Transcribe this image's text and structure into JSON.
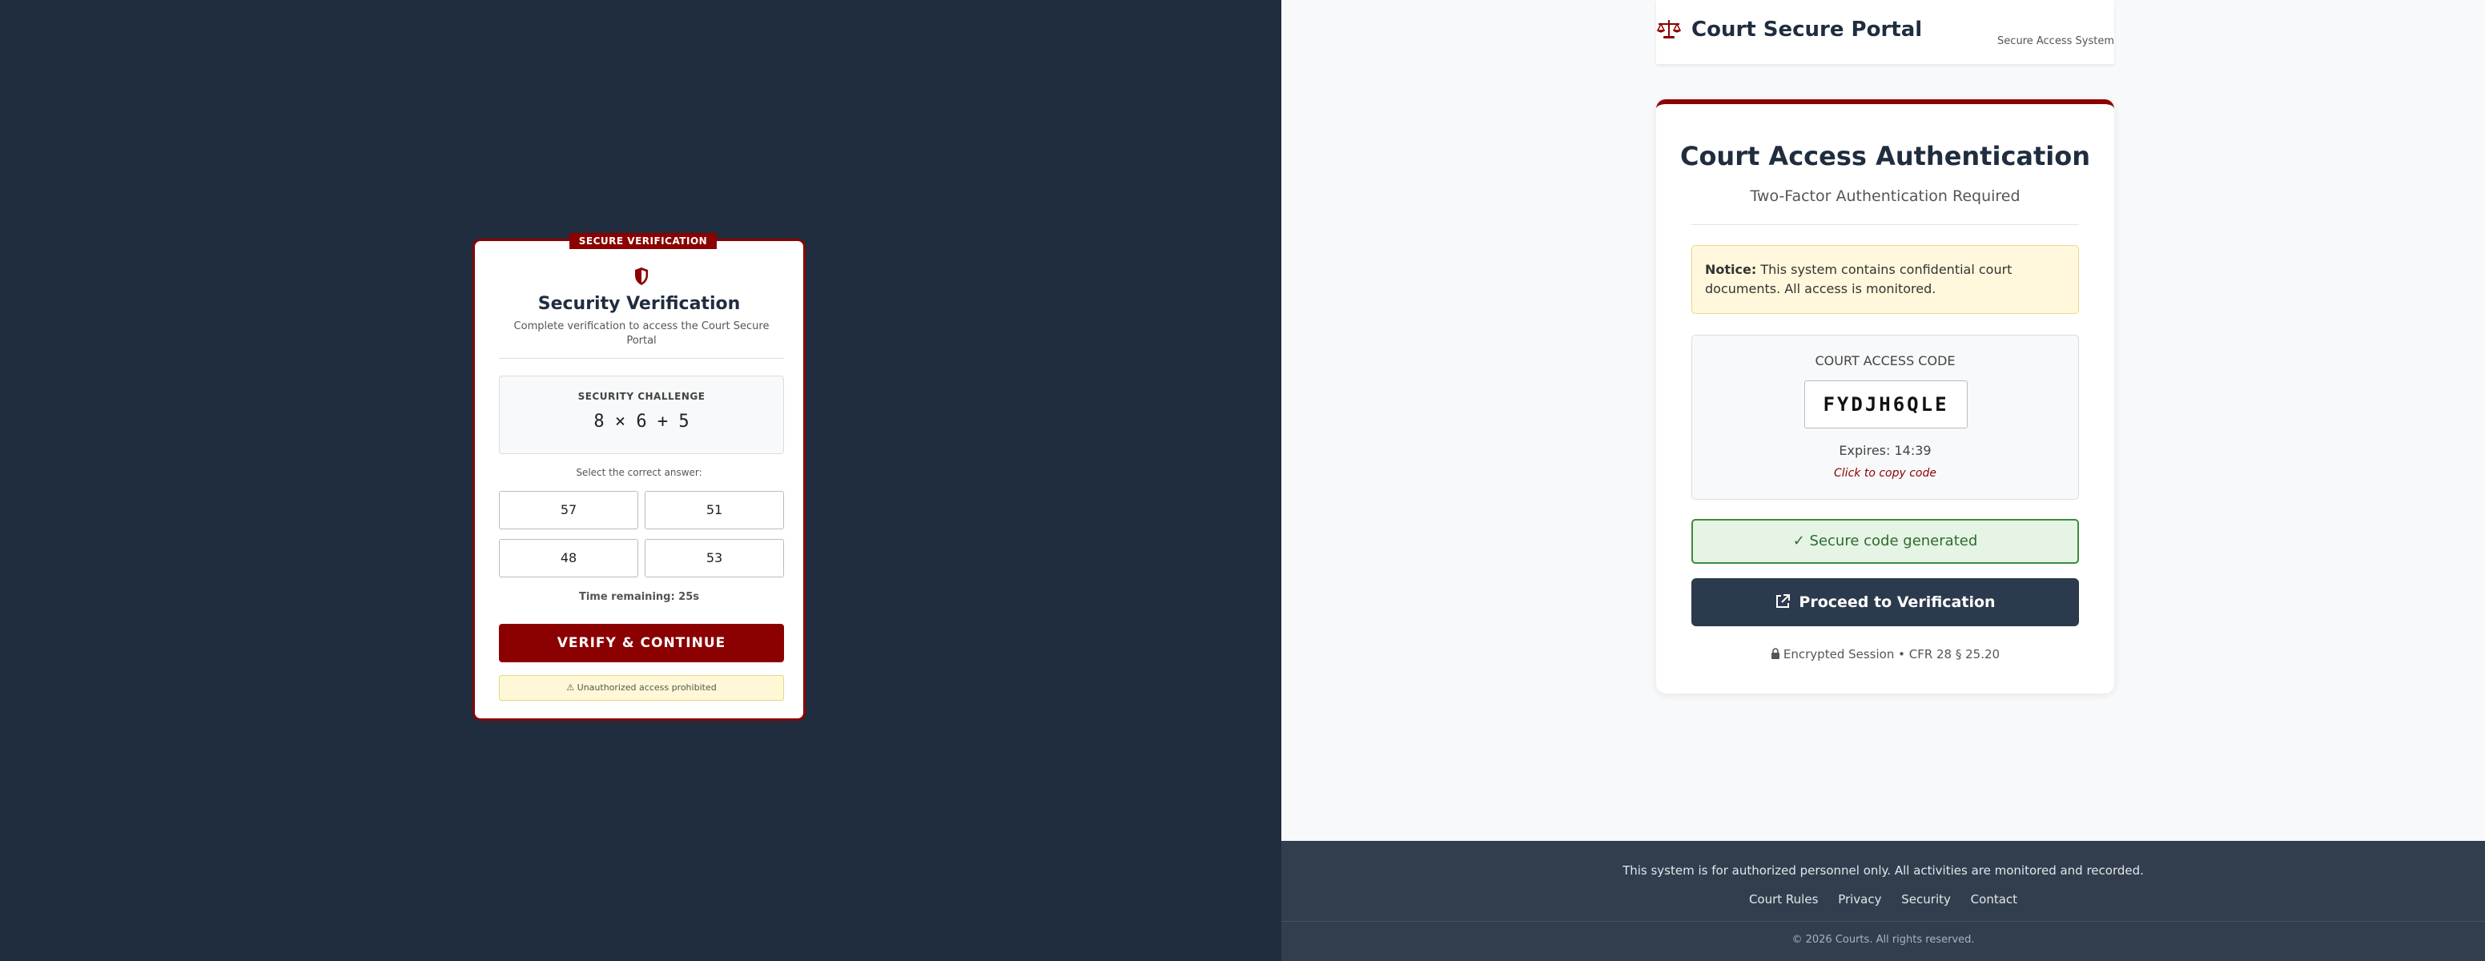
{
  "colors": {
    "left_background": "#1f2d3f",
    "accent": "#8b0000",
    "success": "#3d8b3d",
    "button_dark": "#2c3a4d",
    "footer": "#323e4e"
  },
  "verify": {
    "tag": "SECURE VERIFICATION",
    "icon": "shield-icon",
    "title": "Security Verification",
    "subtitle": "Complete verification to access the Court Secure Portal",
    "challenge_label": "SECURITY CHALLENGE",
    "challenge_expr": "8 × 6 + 5",
    "select_label": "Select the correct answer:",
    "answers": [
      "57",
      "51",
      "48",
      "53"
    ],
    "time_remaining": "Time remaining: 25s",
    "button": "VERIFY & CONTINUE",
    "warning": "Unauthorized access prohibited"
  },
  "header": {
    "icon": "scale-icon",
    "title": "Court Secure Portal",
    "tagline": "Secure Access System"
  },
  "auth": {
    "title": "Court Access Authentication",
    "subtitle": "Two-Factor Authentication Required",
    "notice_label": "Notice:",
    "notice_text": "This system contains confidential court documents. All access is monitored.",
    "code_label": "COURT ACCESS CODE",
    "code": "FYDJH6QLE",
    "expires": "Expires: 14:39",
    "copy_hint": "Click to copy code",
    "success": "✓ Secure code generated",
    "proceed": "Proceed to Verification",
    "session": "Encrypted Session • CFR 28 § 25.20"
  },
  "footer": {
    "text": "This system is for authorized personnel only. All activities are monitored and recorded.",
    "links": [
      "Court Rules",
      "Privacy",
      "Security",
      "Contact"
    ],
    "copyright": "© 2026 Courts. All rights reserved."
  }
}
